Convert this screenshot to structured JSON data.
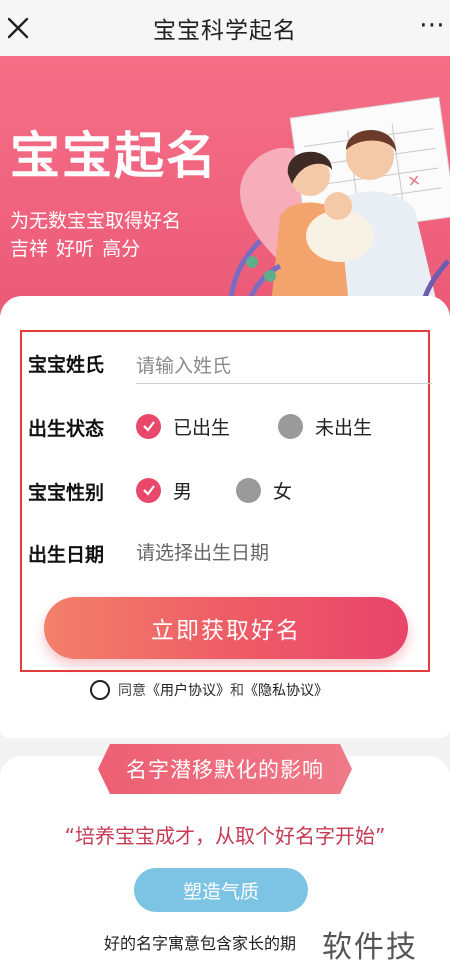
{
  "navbar": {
    "title": "宝宝科学起名",
    "close_icon": "close-icon",
    "more_icon": "more-icon",
    "more_glyph": "⋯"
  },
  "hero": {
    "title": "宝宝起名",
    "subtitle_line1": "为无数宝宝取得好名",
    "subtitle_line2": "吉祥 好听 高分",
    "illustration": "family-holding-baby-illustration",
    "colors": {
      "banner": "#f0627d"
    }
  },
  "form": {
    "surname": {
      "label": "宝宝姓氏",
      "placeholder": "请输入姓氏",
      "value": ""
    },
    "birth_status": {
      "label": "出生状态",
      "options": [
        {
          "label": "已出生",
          "selected": true
        },
        {
          "label": "未出生",
          "selected": false
        }
      ]
    },
    "gender": {
      "label": "宝宝性别",
      "options": [
        {
          "label": "男",
          "selected": true
        },
        {
          "label": "女",
          "selected": false
        }
      ]
    },
    "birth_date": {
      "label": "出生日期",
      "placeholder": "请选择出生日期"
    },
    "submit_label": "立即获取好名",
    "agreement": {
      "prefix": "同意",
      "user_agreement": "《用户协议》",
      "conjunction": "和",
      "privacy_policy": "《隐私协议》",
      "checked": false
    },
    "colors": {
      "accent": "#e9486a",
      "highlight_border": "#e23c3c"
    }
  },
  "influence": {
    "ribbon_title": "名字潜移默化的影响",
    "slogan": "“培养宝宝成才，从取个好名字开始”",
    "pill_button": "塑造气质",
    "body_text": "好的名字寓意包含家长的期",
    "colors": {
      "pill": "#7cc3e4"
    }
  },
  "watermark": "软件技巧"
}
